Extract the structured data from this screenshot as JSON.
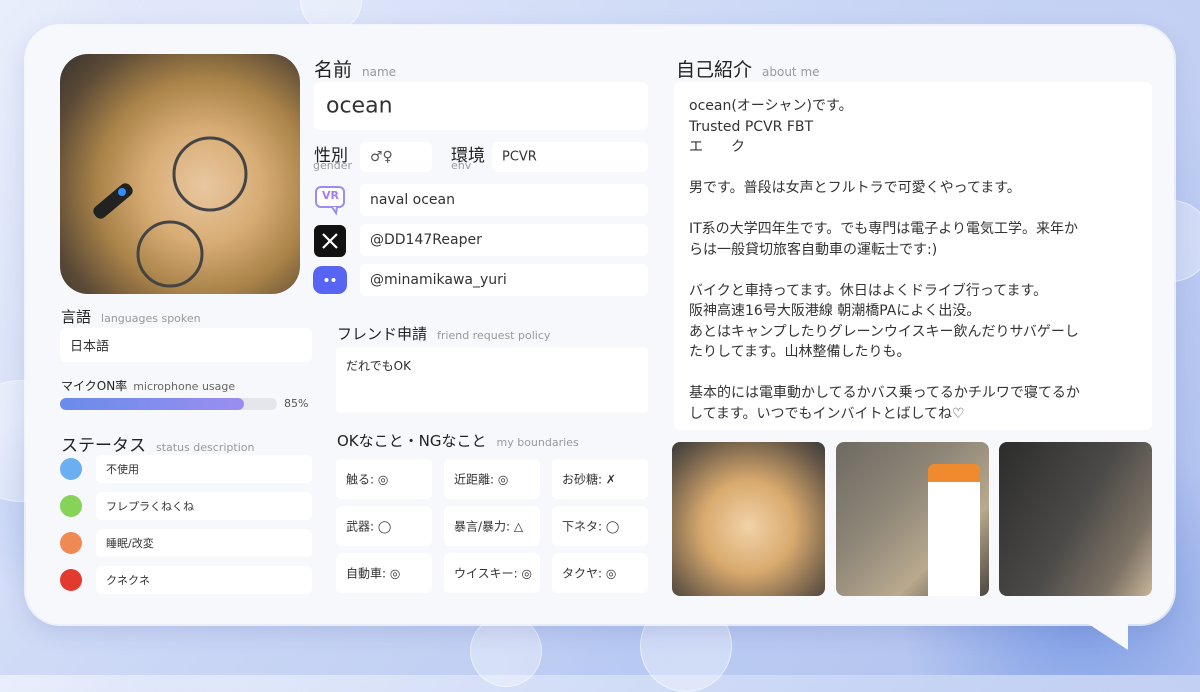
{
  "name_section": {
    "label": "名前",
    "sub": "name",
    "value": "ocean"
  },
  "gender": {
    "label": "性別",
    "sub": "gender",
    "value": "♂♀"
  },
  "env": {
    "label": "環境",
    "sub": "env",
    "value": "PCVR"
  },
  "socials": {
    "vrchat": "naval ocean",
    "x": "@DD147Reaper",
    "discord": "@minamikawa_yuri",
    "vr_icon_text": "VR"
  },
  "languages": {
    "label": "言語",
    "sub": "languages spoken",
    "value": "日本語"
  },
  "mic": {
    "label": "マイクON率",
    "sub": "microphone usage",
    "value": 0.85,
    "value_text": "85%"
  },
  "status": {
    "label": "ステータス",
    "sub": "status description",
    "items": [
      {
        "color": "#6aaff0",
        "text": "不使用"
      },
      {
        "color": "#86d35a",
        "text": "フレプラくねくね"
      },
      {
        "color": "#f08a55",
        "text": "睡眠/改変"
      },
      {
        "color": "#e23a2f",
        "text": "クネクネ"
      }
    ]
  },
  "friend": {
    "label": "フレンド申請",
    "sub": "friend request policy",
    "value": "だれでもOK"
  },
  "boundaries": {
    "label": "OKなこと・NGなこと",
    "sub": "my boundaries",
    "items": [
      "触る: ◎",
      "近距離: ◎",
      "お砂糖: ✗",
      "武器: ◯",
      "暴言/暴力: △",
      "下ネタ: ◯",
      "自動車: ◎",
      "ウイスキー: ◎",
      "タクヤ: ◎"
    ]
  },
  "about": {
    "label": "自己紹介",
    "sub": "about me",
    "lines": [
      "ocean(オーシャン)です。",
      "Trusted PCVR FBT",
      "エ　　ク",
      "",
      "男です。普段は女声とフルトラで可愛くやってます。",
      "",
      "IT系の大学四年生です。でも専門は電子より電気工学。来年か",
      "らは一般貸切旅客自動車の運転士です:)",
      "",
      "バイクと車持ってます。休日はよくドライブ行ってます。",
      "阪神高速16号大阪港線 朝潮橋PAによく出没。",
      "あとはキャンプしたりグレーンウイスキー飲んだりサバゲーし",
      "たりしてます。山林整備したりも。",
      "",
      "基本的には電車動かしてるかバス乗ってるかチルワで寝てるか",
      "してます。いつでもインバイトとばしてね♡"
    ]
  },
  "colors": {
    "accent": "#8f9cec",
    "card": "#f7f8fb"
  }
}
